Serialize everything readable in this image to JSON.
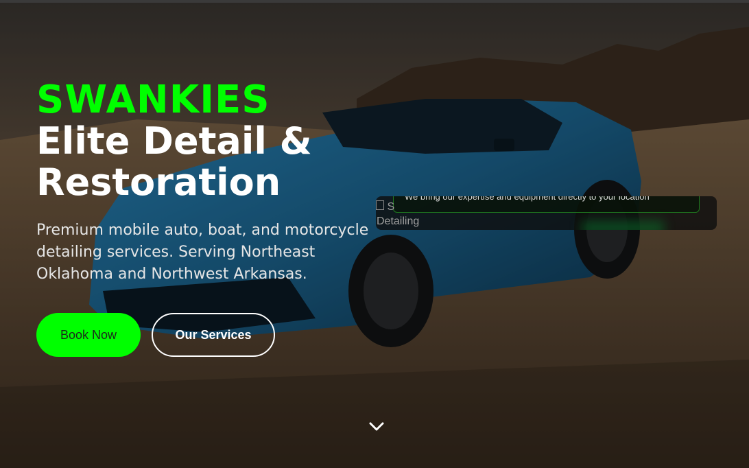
{
  "hero": {
    "brand": "SWANKIES",
    "headline": "Elite Detail & Restoration",
    "tagline": "Premium mobile auto, boat, and motorcycle detailing services. Serving Northeast Oklahoma and Northwest Arkansas.",
    "buttons": {
      "book_now": "Book Now",
      "our_services": "Our Services"
    }
  },
  "card": {
    "image_alt": "S",
    "image_label": "Detailing",
    "pill_text": "We bring our expertise and equipment directly to your location"
  },
  "icons": {
    "scroll": "chevron-down-icon"
  },
  "colors": {
    "accent": "#00ff00",
    "text": "#ffffff",
    "tagline": "#e6e6e6",
    "card_bg": "#0f0f0f",
    "car_body": "#1f6f9a"
  }
}
